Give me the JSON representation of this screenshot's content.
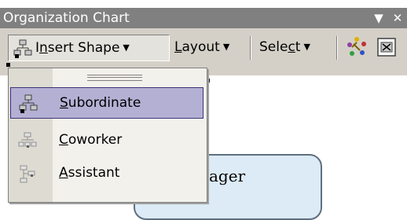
{
  "window": {
    "title": "Organization Chart",
    "dropdown_glyph": "▼",
    "close_glyph": "✕"
  },
  "toolbar": {
    "insert_shape": {
      "prefix": "I",
      "underlined": "n",
      "suffix": "sert Shape",
      "arrow": "▼"
    },
    "layout": {
      "underlined": "L",
      "suffix": "ayout",
      "arrow": "▼"
    },
    "select": {
      "prefix": "Sele",
      "underlined": "c",
      "suffix": "t",
      "arrow": "▼"
    },
    "icons": [
      "autoformat-icon",
      "fit-text-icon"
    ]
  },
  "menu": {
    "items": [
      {
        "underlined": "S",
        "suffix": "ubordinate",
        "icon": "subordinate-icon",
        "selected": true
      },
      {
        "underlined": "C",
        "suffix": "oworker",
        "icon": "coworker-icon",
        "selected": false
      },
      {
        "underlined": "A",
        "suffix": "ssistant",
        "icon": "assistant-icon",
        "selected": false
      }
    ]
  },
  "canvas": {
    "shape_text": "ager"
  },
  "colors": {
    "toolbar_bg": "#d4d0c8",
    "titlebar_bg": "#808080",
    "menu_highlight": "#b4b0d4",
    "shape_fill": "#dcebf6"
  }
}
